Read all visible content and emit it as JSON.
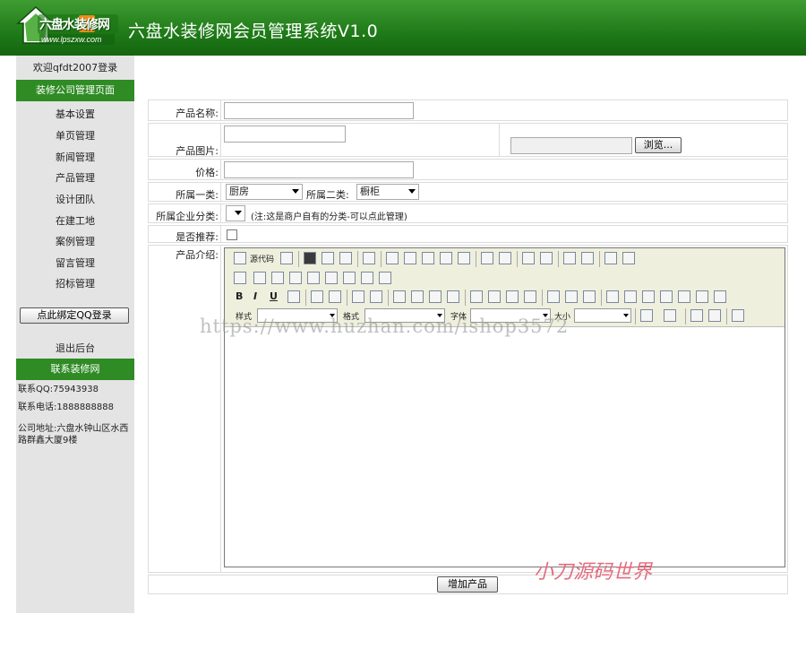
{
  "header": {
    "logo_main": "六盘水装修网",
    "logo_url": "www.lpszxw.com",
    "title": "六盘水装修网会员管理系统V1.0"
  },
  "sidebar": {
    "welcome": "欢迎qfdt2007登录",
    "section_title": "装修公司管理页面",
    "items": [
      "基本设置",
      "单页管理",
      "新闻管理",
      "产品管理",
      "设计团队",
      "在建工地",
      "案例管理",
      "留言管理",
      "招标管理"
    ],
    "qq_button": "点此绑定QQ登录",
    "logout": "退出后台",
    "contact_title": "联系装修网",
    "contact_qq": "联系QQ:75943938",
    "contact_phone": "联系电话:1888888888",
    "contact_address": "公司地址:六盘水钟山区水西路群鑫大厦9楼"
  },
  "form": {
    "product_name_label": "产品名称:",
    "product_image_label": "产品图片:",
    "browse_button": "浏览...",
    "price_label": "价格:",
    "category1_label": "所属一类:",
    "category1_value": "厨房",
    "category2_label": "所属二类:",
    "category2_value": "橱柜",
    "enterprise_category_label": "所属企业分类:",
    "enterprise_category_note": "(注:这是商户自有的分类-可以点此管理)",
    "recommend_label": "是否推荐:",
    "intro_label": "产品介绍:",
    "submit_button": "增加产品"
  },
  "editor": {
    "source_label": "源代码",
    "style_label": "样式",
    "format_label": "格式",
    "font_label": "字体",
    "size_label": "大小"
  },
  "watermarks": {
    "url": "https://www.huzhan.com/ishop3572",
    "brand": "小刀源码世界"
  }
}
